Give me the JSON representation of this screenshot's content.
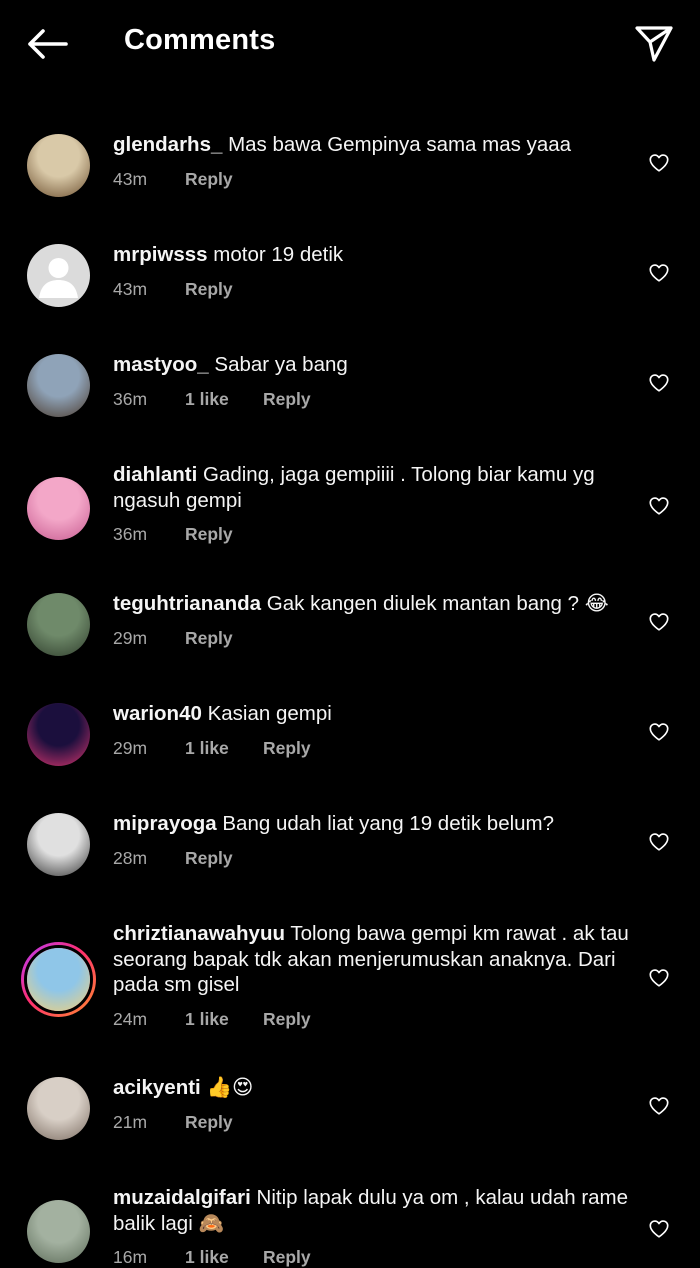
{
  "header": {
    "title": "Comments"
  },
  "comments": [
    {
      "username": "glendarhs_",
      "text": "Mas bawa Gempinya sama mas yaaa",
      "time": "43m",
      "likes": "",
      "reply": "Reply",
      "avatar_colors": [
        "#d9c9a8",
        "#6b4e2e"
      ],
      "story": false
    },
    {
      "username": "mrpiwsss",
      "text": "motor 19 detik",
      "time": "43m",
      "likes": "",
      "reply": "Reply",
      "avatar_colors": [
        "#dcdcdc",
        "#ffffff"
      ],
      "story": false
    },
    {
      "username": "mastyoo_",
      "text": "Sabar ya bang",
      "time": "36m",
      "likes": "1 like",
      "reply": "Reply",
      "avatar_colors": [
        "#8fa3b8",
        "#4b3a2c"
      ],
      "story": false
    },
    {
      "username": "diahlanti",
      "text": "Gading, jaga gempiiii . Tolong biar kamu yg ngasuh gempi",
      "time": "36m",
      "likes": "",
      "reply": "Reply",
      "avatar_colors": [
        "#f3a7c8",
        "#c65a8f"
      ],
      "story": false
    },
    {
      "username": "teguhtriananda",
      "text": "Gak kangen diulek mantan bang ? 😂",
      "time": "29m",
      "likes": "",
      "reply": "Reply",
      "avatar_colors": [
        "#6f8a6a",
        "#2f3d2c"
      ],
      "story": false
    },
    {
      "username": "warion40",
      "text": "Kasian gempi",
      "time": "29m",
      "likes": "1 like",
      "reply": "Reply",
      "avatar_colors": [
        "#1b0f3d",
        "#d8356e"
      ],
      "story": false
    },
    {
      "username": "miprayoga",
      "text": "Bang udah liat yang 19 detik belum?",
      "time": "28m",
      "likes": "",
      "reply": "Reply",
      "avatar_colors": [
        "#e0e0e0",
        "#333333"
      ],
      "story": false
    },
    {
      "username": "chriztianawahyuu",
      "text": "Tolong bawa gempi km rawat . ak tau seorang bapak tdk akan menjerumuskan anaknya. Dari pada sm gisel",
      "time": "24m",
      "likes": "1 like",
      "reply": "Reply",
      "avatar_colors": [
        "#8fc6e8",
        "#f2d17a"
      ],
      "story": true
    },
    {
      "username": "acikyenti",
      "text": "👍😍",
      "time": "21m",
      "likes": "",
      "reply": "Reply",
      "avatar_colors": [
        "#d8cfc6",
        "#7a6b60"
      ],
      "story": false
    },
    {
      "username": "muzaidalgifari",
      "text": "Nitip lapak dulu ya om , kalau udah rame balik lagi 🙈",
      "time": "16m",
      "likes": "1 like",
      "reply": "Reply",
      "avatar_colors": [
        "#a3b1a0",
        "#5c6b58"
      ],
      "story": false
    }
  ]
}
